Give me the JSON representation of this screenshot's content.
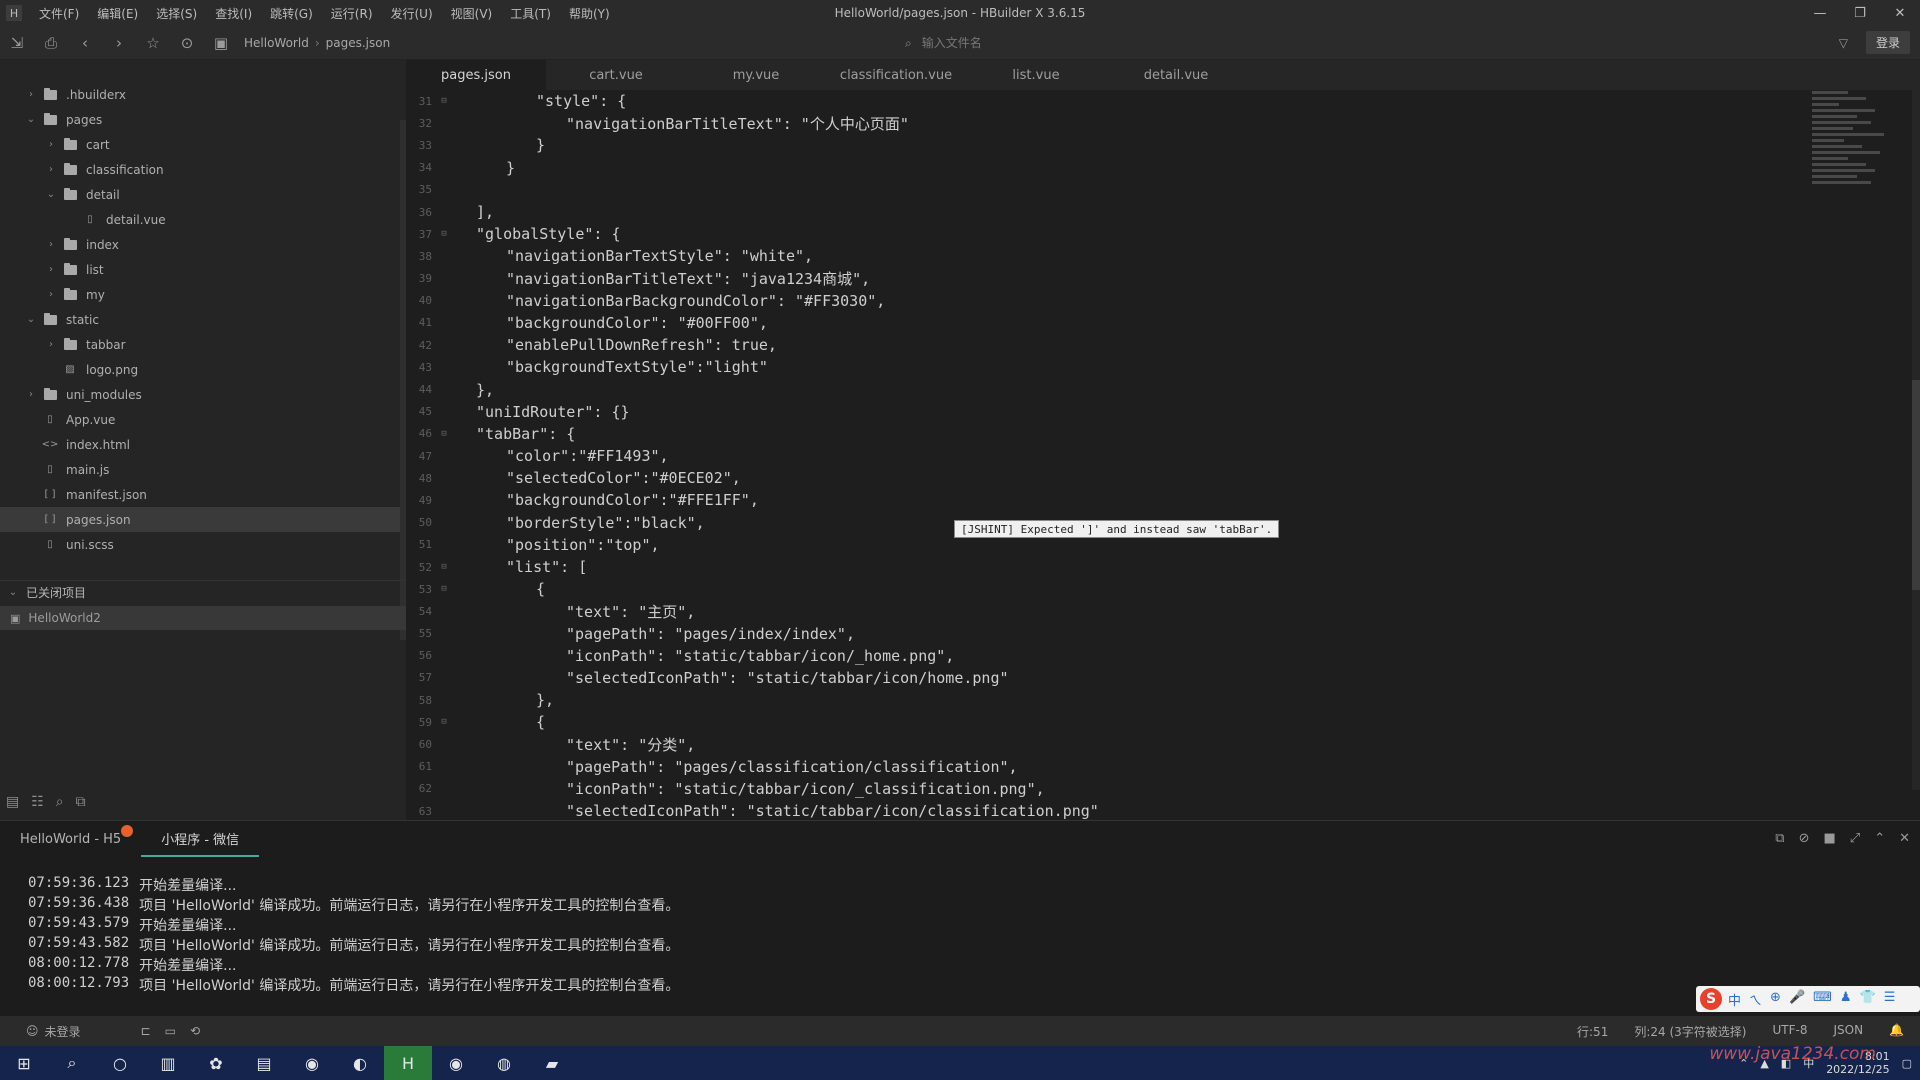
{
  "window": {
    "title": "HelloWorld/pages.json - HBuilder X 3.6.15",
    "menu": [
      "文件(F)",
      "编辑(E)",
      "选择(S)",
      "查找(I)",
      "跳转(G)",
      "运行(R)",
      "发行(U)",
      "视图(V)",
      "工具(T)",
      "帮助(Y)"
    ],
    "controls": [
      "—",
      "❐",
      "✕"
    ]
  },
  "toolbar": {
    "breadcrumb": [
      "HelloWorld",
      "pages.json"
    ],
    "search_placeholder": "输入文件名",
    "login_label": "登录",
    "icons": [
      "new-file-icon",
      "save-icon",
      "back-icon",
      "forward-icon",
      "star-icon",
      "run-icon",
      "terminal-icon",
      "filter-icon"
    ]
  },
  "sidebar": {
    "tree": [
      {
        "label": ".hbuilderx",
        "type": "folder",
        "depth": 0,
        "expanded": false
      },
      {
        "label": "pages",
        "type": "folder",
        "depth": 0,
        "expanded": true
      },
      {
        "label": "cart",
        "type": "folder",
        "depth": 1,
        "expanded": false
      },
      {
        "label": "classification",
        "type": "folder",
        "depth": 1,
        "expanded": false
      },
      {
        "label": "detail",
        "type": "folder",
        "depth": 1,
        "expanded": true
      },
      {
        "label": "detail.vue",
        "type": "file",
        "depth": 2,
        "expanded": null
      },
      {
        "label": "index",
        "type": "folder",
        "depth": 1,
        "expanded": false
      },
      {
        "label": "list",
        "type": "folder",
        "depth": 1,
        "expanded": false
      },
      {
        "label": "my",
        "type": "folder",
        "depth": 1,
        "expanded": false
      },
      {
        "label": "static",
        "type": "folder",
        "depth": 0,
        "expanded": true
      },
      {
        "label": "tabbar",
        "type": "folder",
        "depth": 1,
        "expanded": false
      },
      {
        "label": "logo.png",
        "type": "image",
        "depth": 1,
        "expanded": null
      },
      {
        "label": "uni_modules",
        "type": "folder",
        "depth": 0,
        "expanded": false
      },
      {
        "label": "App.vue",
        "type": "file",
        "depth": 0,
        "expanded": null
      },
      {
        "label": "index.html",
        "type": "code",
        "depth": 0,
        "expanded": null
      },
      {
        "label": "main.js",
        "type": "file",
        "depth": 0,
        "expanded": null
      },
      {
        "label": "manifest.json",
        "type": "json",
        "depth": 0,
        "expanded": null
      },
      {
        "label": "pages.json",
        "type": "json",
        "depth": 0,
        "expanded": null,
        "selected": true
      },
      {
        "label": "uni.scss",
        "type": "file",
        "depth": 0,
        "expanded": null
      }
    ],
    "closed_projects_header": "已关闭项目",
    "closed_project": "HelloWorld2",
    "bottom_icons": [
      "explorer-icon",
      "list-icon",
      "search-icon",
      "plugin-icon"
    ]
  },
  "editor": {
    "tabs": [
      "pages.json",
      "cart.vue",
      "my.vue",
      "classification.vue",
      "list.vue",
      "detail.vue"
    ],
    "active_tab": 0,
    "tooltip": "[JSHINT] Expected ']' and instead saw 'tabBar'.",
    "lines": [
      {
        "n": "31",
        "text": "\"style\": {",
        "indent": 2,
        "fold": "⊟"
      },
      {
        "n": "32",
        "text": "\"navigationBarTitleText\": \"个人中心页面\"",
        "indent": 3,
        "fold": ""
      },
      {
        "n": "33",
        "text": "}",
        "indent": 2,
        "fold": ""
      },
      {
        "n": "34",
        "text": "}",
        "indent": 1,
        "fold": ""
      },
      {
        "n": "35",
        "text": "",
        "indent": 0,
        "fold": ""
      },
      {
        "n": "36",
        "text": "],",
        "indent": 0,
        "fold": ""
      },
      {
        "n": "37",
        "text": "\"globalStyle\": {",
        "indent": 0,
        "fold": "⊟"
      },
      {
        "n": "38",
        "text": "\"navigationBarTextStyle\": \"white\",",
        "indent": 1,
        "fold": ""
      },
      {
        "n": "39",
        "text": "\"navigationBarTitleText\": \"java1234商城\",",
        "indent": 1,
        "fold": ""
      },
      {
        "n": "40",
        "text": "\"navigationBarBackgroundColor\": \"#FF3030\",",
        "indent": 1,
        "fold": ""
      },
      {
        "n": "41",
        "text": "\"backgroundColor\": \"#00FF00\",",
        "indent": 1,
        "fold": ""
      },
      {
        "n": "42",
        "text": "\"enablePullDownRefresh\": true,",
        "indent": 1,
        "fold": ""
      },
      {
        "n": "43",
        "text": "\"backgroundTextStyle\":\"light\"",
        "indent": 1,
        "fold": ""
      },
      {
        "n": "44",
        "text": "},",
        "indent": 0,
        "fold": ""
      },
      {
        "n": "45",
        "text": "\"uniIdRouter\": {}",
        "indent": 0,
        "fold": ""
      },
      {
        "n": "46",
        "text": "\"tabBar\": {",
        "indent": 0,
        "fold": "⊟"
      },
      {
        "n": "47",
        "text": "\"color\":\"#FF1493\",",
        "indent": 1,
        "fold": ""
      },
      {
        "n": "48",
        "text": "\"selectedColor\":\"#0ECE02\",",
        "indent": 1,
        "fold": ""
      },
      {
        "n": "49",
        "text": "\"backgroundColor\":\"#FFE1FF\",",
        "indent": 1,
        "fold": ""
      },
      {
        "n": "50",
        "text": "\"borderStyle\":\"black\",",
        "indent": 1,
        "fold": ""
      },
      {
        "n": "51",
        "text": "\"position\":\"top\",",
        "indent": 1,
        "fold": ""
      },
      {
        "n": "52",
        "text": "\"list\": [",
        "indent": 1,
        "fold": "⊟"
      },
      {
        "n": "53",
        "text": "{",
        "indent": 2,
        "fold": "⊟"
      },
      {
        "n": "54",
        "text": "\"text\": \"主页\",",
        "indent": 3,
        "fold": ""
      },
      {
        "n": "55",
        "text": "\"pagePath\": \"pages/index/index\",",
        "indent": 3,
        "fold": ""
      },
      {
        "n": "56",
        "text": "\"iconPath\": \"static/tabbar/icon/_home.png\",",
        "indent": 3,
        "fold": ""
      },
      {
        "n": "57",
        "text": "\"selectedIconPath\": \"static/tabbar/icon/home.png\"",
        "indent": 3,
        "fold": ""
      },
      {
        "n": "58",
        "text": "},",
        "indent": 2,
        "fold": ""
      },
      {
        "n": "59",
        "text": "{",
        "indent": 2,
        "fold": "⊟"
      },
      {
        "n": "60",
        "text": "\"text\": \"分类\",",
        "indent": 3,
        "fold": ""
      },
      {
        "n": "61",
        "text": "\"pagePath\": \"pages/classification/classification\",",
        "indent": 3,
        "fold": ""
      },
      {
        "n": "62",
        "text": "\"iconPath\": \"static/tabbar/icon/_classification.png\",",
        "indent": 3,
        "fold": ""
      },
      {
        "n": "63",
        "text": "\"selectedIconPath\": \"static/tabbar/icon/classification.png\"",
        "indent": 3,
        "fold": ""
      }
    ]
  },
  "console": {
    "tabs": [
      "HelloWorld - H5",
      "小程序 - 微信"
    ],
    "active_tab": 1,
    "logs": [
      {
        "time": "07:59:36.123",
        "msg": "开始差量编译..."
      },
      {
        "time": "07:59:36.438",
        "msg": "项目 'HelloWorld' 编译成功。前端运行日志，请另行在小程序开发工具的控制台查看。"
      },
      {
        "time": "07:59:43.579",
        "msg": "开始差量编译..."
      },
      {
        "time": "07:59:43.582",
        "msg": "项目 'HelloWorld' 编译成功。前端运行日志，请另行在小程序开发工具的控制台查看。"
      },
      {
        "time": "08:00:12.778",
        "msg": "开始差量编译..."
      },
      {
        "time": "08:00:12.793",
        "msg": "项目 'HelloWorld' 编译成功。前端运行日志，请另行在小程序开发工具的控制台查看。"
      }
    ],
    "ime_chars": [
      "中",
      "ㄟ",
      "⊕",
      "🎤",
      "⌨",
      "♟",
      "👕",
      "☰"
    ]
  },
  "status": {
    "left": "未登录",
    "right": [
      "行:51",
      "列:24 (3字符被选择)",
      "UTF-8",
      "JSON"
    ]
  },
  "taskbar": {
    "time": "8:01",
    "date": "2022/12/25",
    "watermark": "www.java1234.com"
  }
}
